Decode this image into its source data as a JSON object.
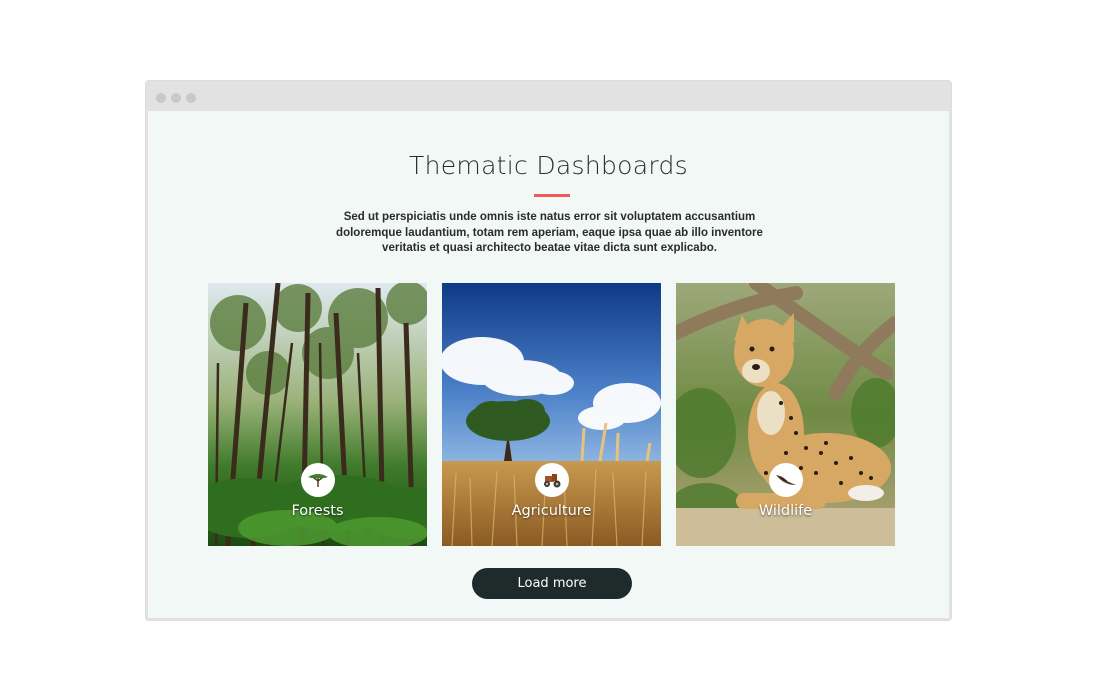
{
  "section": {
    "title": "Thematic Dashboards",
    "description": "Sed ut perspiciatis unde omnis iste natus error sit voluptatem accusantium doloremque laudantium, totam rem aperiam, eaque ipsa quae ab illo inventore veritatis et quasi architecto beatae vitae dicta sunt explicabo."
  },
  "cards": [
    {
      "label": "Forests",
      "icon": "tree-icon"
    },
    {
      "label": "Agriculture",
      "icon": "tractor-icon"
    },
    {
      "label": "Wildlife",
      "icon": "bird-icon"
    }
  ],
  "load_more": {
    "label": "Load more"
  },
  "colors": {
    "accent": "#f05a5a",
    "button": "#1f2a2a",
    "background": "#f1f8f5"
  }
}
